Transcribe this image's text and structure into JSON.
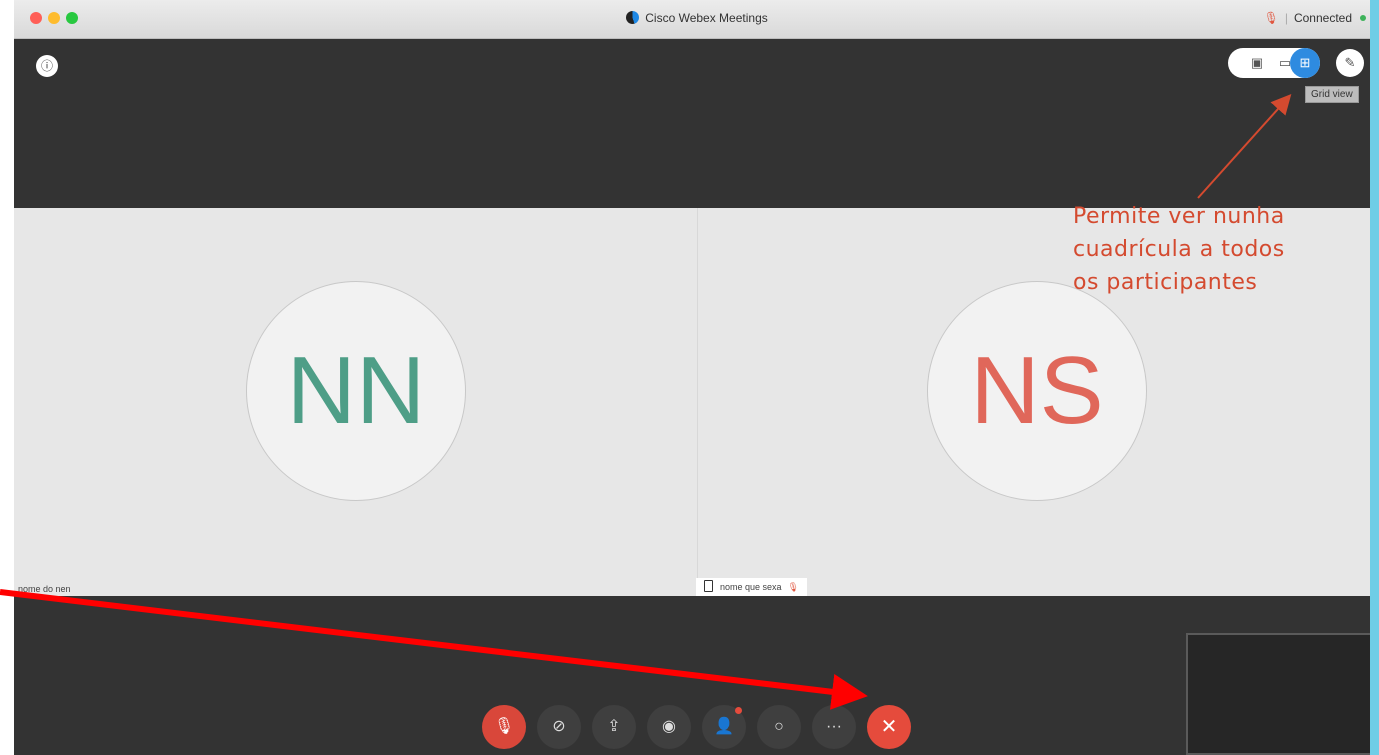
{
  "window": {
    "title": "Cisco Webex Meetings",
    "status_text": "Connected",
    "mic_icon": "mic-muted-icon",
    "status_dot_color": "#3db25a"
  },
  "top_controls": {
    "info_icon": "info-icon",
    "layout_views": [
      {
        "name": "floating",
        "icon": "pip-view-icon"
      },
      {
        "name": "stage",
        "icon": "stage-view-icon"
      },
      {
        "name": "grid",
        "icon": "grid-view-icon",
        "active": true
      }
    ],
    "annotate_icon": "pencil-icon",
    "tooltip": "Grid view"
  },
  "participants": [
    {
      "initials": "NN",
      "display_name": "nome do nen",
      "color": "#4e9e87"
    },
    {
      "initials": "NS",
      "display_name": "nome que sexa",
      "color": "#e0675a"
    }
  ],
  "annotation": {
    "lines": [
      "Permite ver nunha",
      "cuadrícula a todos",
      "os participantes"
    ],
    "color": "#d44a2f"
  },
  "controls": [
    {
      "name": "mute",
      "icon": "mic-muted-icon",
      "glyph": "🎙"
    },
    {
      "name": "video",
      "icon": "video-off-icon",
      "glyph": "⊘"
    },
    {
      "name": "share",
      "icon": "share-icon",
      "glyph": "⇪"
    },
    {
      "name": "record",
      "icon": "record-icon",
      "glyph": "◉"
    },
    {
      "name": "participants",
      "icon": "participants-icon",
      "glyph": "👤"
    },
    {
      "name": "chat",
      "icon": "chat-icon",
      "glyph": "○"
    },
    {
      "name": "more",
      "icon": "more-icon",
      "glyph": "···"
    },
    {
      "name": "leave",
      "icon": "close-icon",
      "glyph": "✕"
    }
  ],
  "colors": {
    "accent": "#2e8be0",
    "leave_red": "#e54b3c",
    "arrow_red": "#ff0000",
    "annotation_arrow": "#d44a2f"
  }
}
